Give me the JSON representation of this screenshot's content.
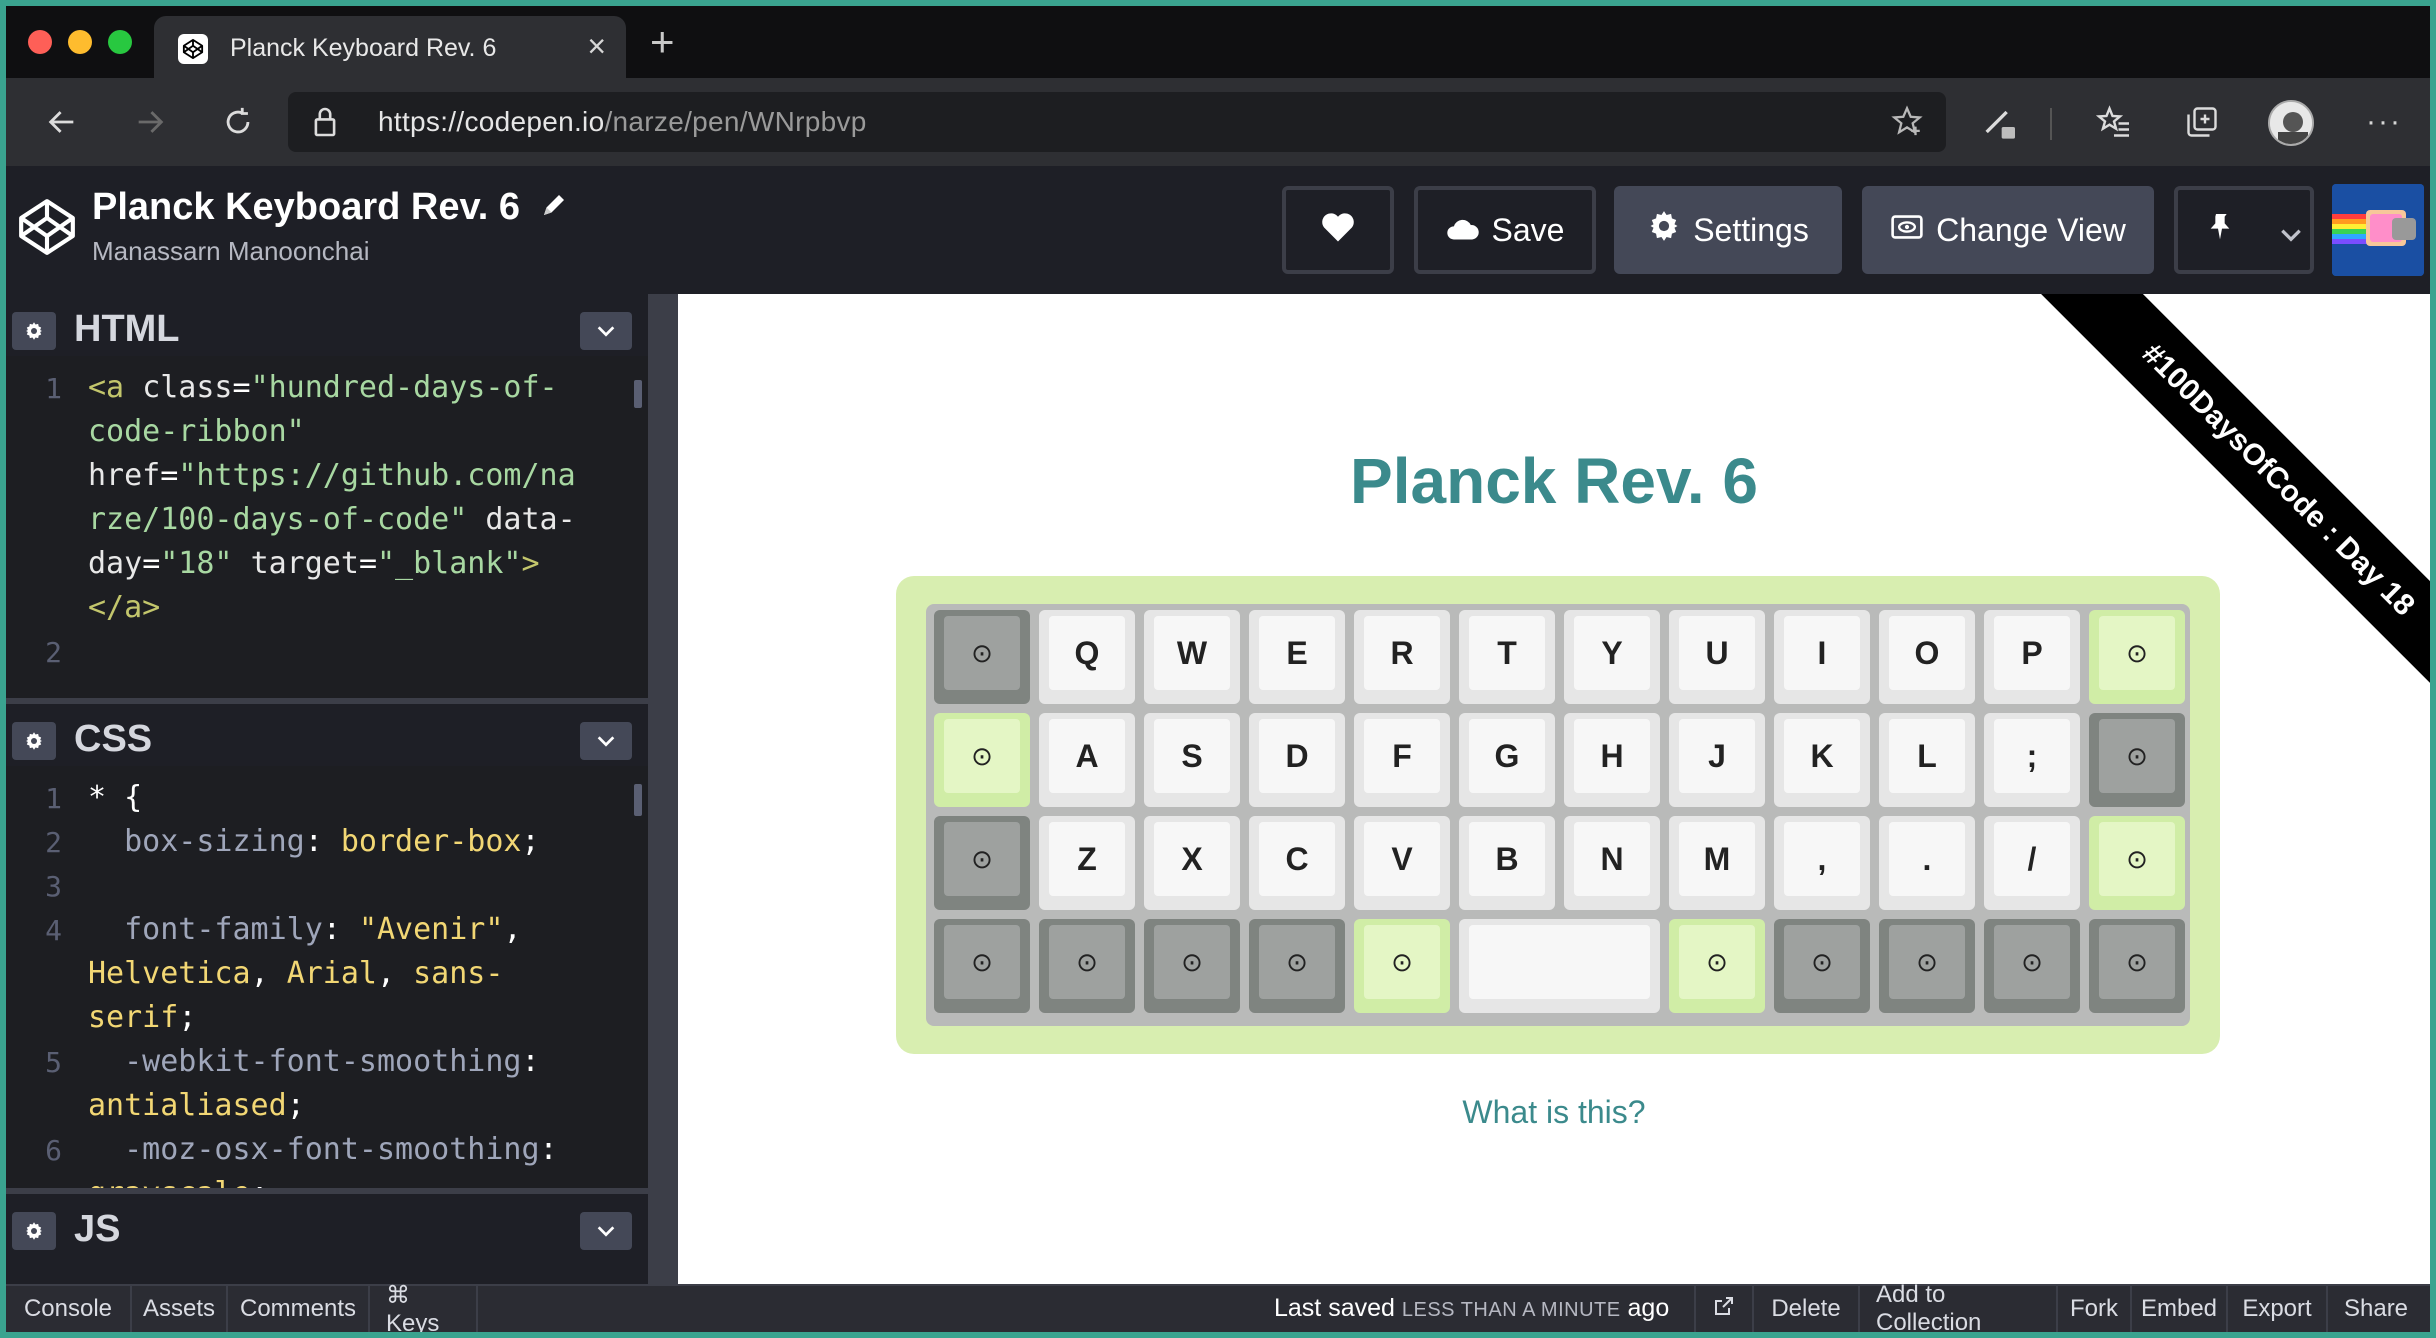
{
  "browser": {
    "tab_title": "Planck Keyboard Rev. 6",
    "url_host": "https://codepen.io",
    "url_path": "/narze/pen/WNrpbvp"
  },
  "header": {
    "pen_title": "Planck Keyboard Rev. 6",
    "author": "Manassarn Manoonchai",
    "save_label": "Save",
    "settings_label": "Settings",
    "change_view_label": "Change View"
  },
  "editors": {
    "html": {
      "title": "HTML",
      "lines": [
        {
          "n": "1",
          "parts": [
            [
              "tag",
              "<a "
            ],
            [
              "attr",
              "class"
            ],
            [
              "plain",
              "="
            ],
            [
              "str",
              "\"hundred-days-of-"
            ]
          ]
        },
        {
          "n": "",
          "parts": [
            [
              "str",
              "code-ribbon\""
            ]
          ]
        },
        {
          "n": "",
          "parts": [
            [
              "attr",
              "href"
            ],
            [
              "plain",
              "="
            ],
            [
              "str",
              "\"https://github.com/na"
            ]
          ]
        },
        {
          "n": "",
          "parts": [
            [
              "str",
              "rze/100-days-of-code\""
            ],
            [
              "plain",
              " "
            ],
            [
              "attr",
              "data-"
            ]
          ]
        },
        {
          "n": "",
          "parts": [
            [
              "attr",
              "day"
            ],
            [
              "plain",
              "="
            ],
            [
              "str",
              "\"18\""
            ],
            [
              "plain",
              " "
            ],
            [
              "attr",
              "target"
            ],
            [
              "plain",
              "="
            ],
            [
              "str",
              "\"_blank\""
            ],
            [
              "tag",
              ">"
            ]
          ]
        },
        {
          "n": "",
          "parts": [
            [
              "tag",
              "</a>"
            ]
          ]
        },
        {
          "n": "2",
          "parts": []
        }
      ]
    },
    "css": {
      "title": "CSS",
      "lines": [
        {
          "n": "1",
          "parts": [
            [
              "plain",
              "* {"
            ]
          ]
        },
        {
          "n": "2",
          "parts": [
            [
              "prop",
              "  box-sizing"
            ],
            [
              "plain",
              ": "
            ],
            [
              "val",
              "border-box"
            ],
            [
              "plain",
              ";"
            ]
          ]
        },
        {
          "n": "3",
          "parts": []
        },
        {
          "n": "4",
          "parts": [
            [
              "prop",
              "  font-family"
            ],
            [
              "plain",
              ": "
            ],
            [
              "val",
              "\"Avenir\""
            ],
            [
              "plain",
              ","
            ]
          ]
        },
        {
          "n": "",
          "parts": [
            [
              "val",
              "Helvetica"
            ],
            [
              "plain",
              ", "
            ],
            [
              "val",
              "Arial"
            ],
            [
              "plain",
              ", "
            ],
            [
              "val",
              "sans-"
            ]
          ]
        },
        {
          "n": "",
          "parts": [
            [
              "val",
              "serif"
            ],
            [
              "plain",
              ";"
            ]
          ]
        },
        {
          "n": "5",
          "parts": [
            [
              "prop",
              "  -webkit-font-smoothing"
            ],
            [
              "plain",
              ":"
            ]
          ]
        },
        {
          "n": "",
          "parts": [
            [
              "val",
              "antialiased"
            ],
            [
              "plain",
              ";"
            ]
          ]
        },
        {
          "n": "6",
          "parts": [
            [
              "prop",
              "  -moz-osx-font-smoothing"
            ],
            [
              "plain",
              ":"
            ]
          ]
        },
        {
          "n": "",
          "parts": [
            [
              "val",
              "grayscale"
            ],
            [
              "plain",
              ";"
            ]
          ]
        }
      ]
    },
    "js": {
      "title": "JS"
    }
  },
  "preview": {
    "title": "Planck Rev. 6",
    "ribbon_text": "#100DaysOfCode : Day 18",
    "link_text": "What is this?",
    "dot_glyph": "⊙",
    "rows": [
      [
        [
          "d",
          "⊙"
        ],
        [
          "l",
          "Q"
        ],
        [
          "l",
          "W"
        ],
        [
          "l",
          "E"
        ],
        [
          "l",
          "R"
        ],
        [
          "l",
          "T"
        ],
        [
          "l",
          "Y"
        ],
        [
          "l",
          "U"
        ],
        [
          "l",
          "I"
        ],
        [
          "l",
          "O"
        ],
        [
          "l",
          "P"
        ],
        [
          "g",
          "⊙"
        ]
      ],
      [
        [
          "g",
          "⊙"
        ],
        [
          "l",
          "A"
        ],
        [
          "l",
          "S"
        ],
        [
          "l",
          "D"
        ],
        [
          "l",
          "F"
        ],
        [
          "l",
          "G"
        ],
        [
          "l",
          "H"
        ],
        [
          "l",
          "J"
        ],
        [
          "l",
          "K"
        ],
        [
          "l",
          "L"
        ],
        [
          "l",
          ";"
        ],
        [
          "d",
          "⊙"
        ]
      ],
      [
        [
          "d",
          "⊙"
        ],
        [
          "l",
          "Z"
        ],
        [
          "l",
          "X"
        ],
        [
          "l",
          "C"
        ],
        [
          "l",
          "V"
        ],
        [
          "l",
          "B"
        ],
        [
          "l",
          "N"
        ],
        [
          "l",
          "M"
        ],
        [
          "l",
          ","
        ],
        [
          "l",
          "."
        ],
        [
          "l",
          "/"
        ],
        [
          "g",
          "⊙"
        ]
      ],
      [
        [
          "d",
          "⊙"
        ],
        [
          "d",
          "⊙"
        ],
        [
          "d",
          "⊙"
        ],
        [
          "d",
          "⊙"
        ],
        [
          "g",
          "⊙"
        ],
        [
          "space",
          ""
        ],
        [
          "g",
          "⊙"
        ],
        [
          "d",
          "⊙"
        ],
        [
          "d",
          "⊙"
        ],
        [
          "d",
          "⊙"
        ],
        [
          "d",
          "⊙"
        ]
      ]
    ]
  },
  "footer": {
    "console": "Console",
    "assets": "Assets",
    "comments": "Comments",
    "keys": "⌘ Keys",
    "saved_prefix": "Last saved",
    "saved_time": "LESS THAN A MINUTE",
    "saved_suffix": "ago",
    "delete": "Delete",
    "add_to_collection": "Add to Collection",
    "fork": "Fork",
    "embed": "Embed",
    "export": "Export",
    "share": "Share"
  },
  "colors": {
    "preview_accent": "#3b8a8c",
    "key_green": "#d0eda6",
    "key_dark": "#7f8480",
    "keyboard_case": "#d8eeb0"
  }
}
